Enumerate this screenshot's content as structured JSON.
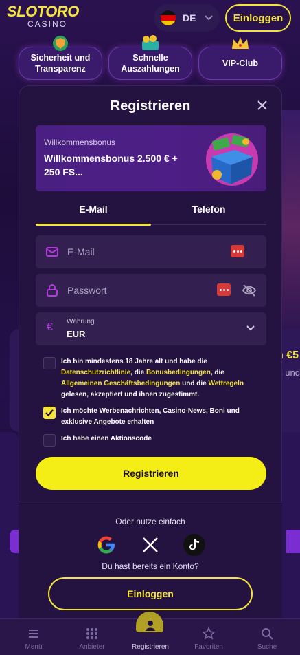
{
  "header": {
    "logo_main": "SLOTORO",
    "logo_sub": "CASINO",
    "language": "DE",
    "login_label": "Einloggen"
  },
  "features": [
    {
      "label": "Sicherheit und Transparenz",
      "icon": "shield-icon"
    },
    {
      "label": "Schnelle Auszahlungen",
      "icon": "wallet-icon"
    },
    {
      "label": "VIP-Club",
      "icon": "crown-icon"
    }
  ],
  "background_peek": {
    "amount": "n €5",
    "text": "s und"
  },
  "modal": {
    "title": "Registrieren",
    "bonus": {
      "kicker": "Willkommensbonus",
      "title": "Willkommensbonus 2.500 € + 250 FS..."
    },
    "tabs": [
      {
        "label": "E-Mail",
        "active": true
      },
      {
        "label": "Telefon",
        "active": false
      }
    ],
    "email": {
      "placeholder": "E-Mail",
      "value": ""
    },
    "password": {
      "placeholder": "Passwort",
      "value": ""
    },
    "currency": {
      "label": "Währung",
      "value": "EUR",
      "symbol": "€"
    },
    "consent_age": {
      "checked": false,
      "text_before": "Ich bin mindestens 18 Jahre alt und habe die ",
      "link_privacy": "Datenschutzrichtlinie",
      "text_1": ", die ",
      "link_bonus": "Bonusbedingungen",
      "text_2": ", die ",
      "link_terms": "Allgemeinen Geschäftsbedingungen",
      "text_3": " und die ",
      "link_betting": "Wettregeln",
      "text_after": " gelesen, akzeptiert und ihnen zugestimmt."
    },
    "consent_marketing": {
      "checked": true,
      "text": "Ich möchte Werbenachrichten, Casino-News, Boni und exklusive Angebote erhalten"
    },
    "promo_code": {
      "checked": false,
      "text": "Ich habe einen Aktionscode"
    },
    "submit_label": "Registrieren",
    "or_text": "Oder nutze einfach",
    "social": [
      "google-icon",
      "x-icon",
      "tiktok-icon"
    ],
    "have_account": "Du hast bereits ein Konto?",
    "login_label": "Einloggen"
  },
  "bottom_nav": [
    {
      "label": "Menü",
      "icon": "menu-icon"
    },
    {
      "label": "Anbieter",
      "icon": "grid-icon"
    },
    {
      "label": "Registrieren",
      "icon": "user-add-icon"
    },
    {
      "label": "Favoriten",
      "icon": "star-icon"
    },
    {
      "label": "Suche",
      "icon": "search-icon"
    }
  ],
  "colors": {
    "accent": "#f5e43a",
    "background": "#1f0f3d",
    "modal": "#241340",
    "field": "#332050"
  }
}
